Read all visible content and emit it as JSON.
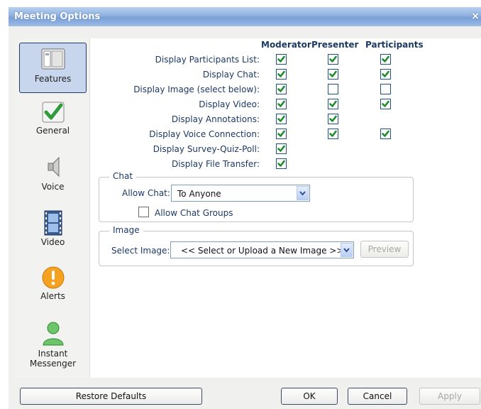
{
  "window": {
    "title": "Meeting Options",
    "close_glyph": "×"
  },
  "sidebar": {
    "items": [
      {
        "label": "Features",
        "icon": "window-icon",
        "active": true
      },
      {
        "label": "General",
        "icon": "checkmark-icon"
      },
      {
        "label": "Voice",
        "icon": "speaker-icon"
      },
      {
        "label": "Video",
        "icon": "film-icon"
      },
      {
        "label": "Alerts",
        "icon": "alert-icon"
      },
      {
        "label": "Instant",
        "label2": "Messenger",
        "icon": "user-icon"
      }
    ]
  },
  "features": {
    "columns": [
      "Moderator",
      "Presenter",
      "Participants"
    ],
    "rows": [
      {
        "label": "Display Participants List:",
        "checks": [
          true,
          true,
          true
        ]
      },
      {
        "label": "Display Chat:",
        "checks": [
          true,
          true,
          true
        ]
      },
      {
        "label": "Display Image (select below):",
        "checks": [
          true,
          false,
          false
        ]
      },
      {
        "label": "Display Video:",
        "checks": [
          true,
          true,
          true
        ]
      },
      {
        "label": "Display Annotations:",
        "checks": [
          true,
          true,
          null
        ]
      },
      {
        "label": "Display Voice Connection:",
        "checks": [
          true,
          true,
          true
        ]
      },
      {
        "label": "Display Survey-Quiz-Poll:",
        "checks": [
          true,
          null,
          null
        ]
      },
      {
        "label": "Display File Transfer:",
        "checks": [
          true,
          null,
          null
        ]
      }
    ]
  },
  "chat": {
    "group_title": "Chat",
    "allow_label": "Allow Chat:",
    "allow_value": "To Anyone",
    "groups_label": "Allow Chat Groups",
    "groups_checked": false
  },
  "image": {
    "group_title": "Image",
    "select_label": "Select Image:",
    "select_value": "<< Select or Upload a New Image >>",
    "preview_label": "Preview"
  },
  "buttons": {
    "restore": "Restore Defaults",
    "ok": "OK",
    "cancel": "Cancel",
    "apply": "Apply"
  },
  "colors": {
    "title_bar": "#8fb0de",
    "label_text": "#1d3a64",
    "check_green": "#1f8a2e"
  }
}
